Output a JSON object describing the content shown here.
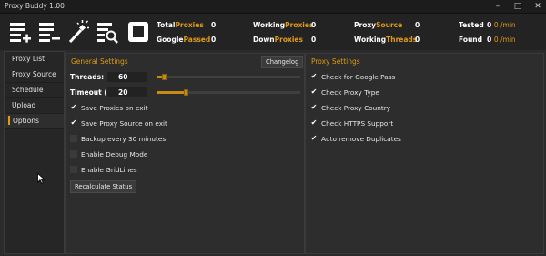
{
  "window": {
    "title": "Proxy Buddy 1.00",
    "minimize": "–",
    "maximize": "□",
    "close": "✕"
  },
  "toolbar": {
    "buttons": [
      "add-list-icon",
      "remove-list-icon",
      "magic-wand-icon",
      "list-search-icon",
      "stop-icon"
    ]
  },
  "stats": {
    "total_a": "Total",
    "total_b": "Proxies",
    "total_val": "0",
    "google_a": "Google",
    "google_b": "Passed",
    "google_val": "0",
    "working_a": "Working",
    "working_b": "Proxies",
    "working_val": "0",
    "down_a": "Down",
    "down_b": "Proxies",
    "down_val": "0",
    "source_a": "Proxy",
    "source_b": "Source",
    "source_val": "0",
    "wthreads_a": "Working",
    "wthreads_b": "Threads",
    "wthreads_val": "0",
    "tested_label": "Tested",
    "tested_val": "0",
    "tested_rate": "0 /min",
    "found_label": "Found",
    "found_val": "0",
    "found_rate": "0 /min"
  },
  "sidebar": {
    "items": [
      {
        "label": "Proxy List"
      },
      {
        "label": "Proxy Source"
      },
      {
        "label": "Schedule"
      },
      {
        "label": "Upload"
      },
      {
        "label": "Options"
      }
    ],
    "active_index": 4
  },
  "general": {
    "title": "General Settings",
    "changelog": "Changelog",
    "threads_label": "Threads:",
    "threads_value": "60",
    "threads_fraction": 0.05,
    "timeout_label": "Timeout (s):",
    "timeout_value": "20",
    "timeout_fraction": 0.2,
    "checks": [
      {
        "label": "Save Proxies on exit",
        "checked": true
      },
      {
        "label": "Save Proxy Source on exit",
        "checked": true
      },
      {
        "label": "Backup every 30 minutes",
        "checked": false
      },
      {
        "label": "Enable Debug Mode",
        "checked": false
      },
      {
        "label": "Enable GridLines",
        "checked": false
      }
    ],
    "recalc": "Recalculate Status"
  },
  "proxy": {
    "title": "Proxy Settings",
    "checks": [
      {
        "label": "Check for Google Pass",
        "checked": true
      },
      {
        "label": "Check Proxy Type",
        "checked": true
      },
      {
        "label": "Check Proxy Country",
        "checked": true
      },
      {
        "label": "Check HTTPS Support",
        "checked": true
      },
      {
        "label": "Auto remove Duplicates",
        "checked": true
      }
    ]
  },
  "colors": {
    "accent": "#e09a12",
    "bg": "#2b2b2b"
  }
}
